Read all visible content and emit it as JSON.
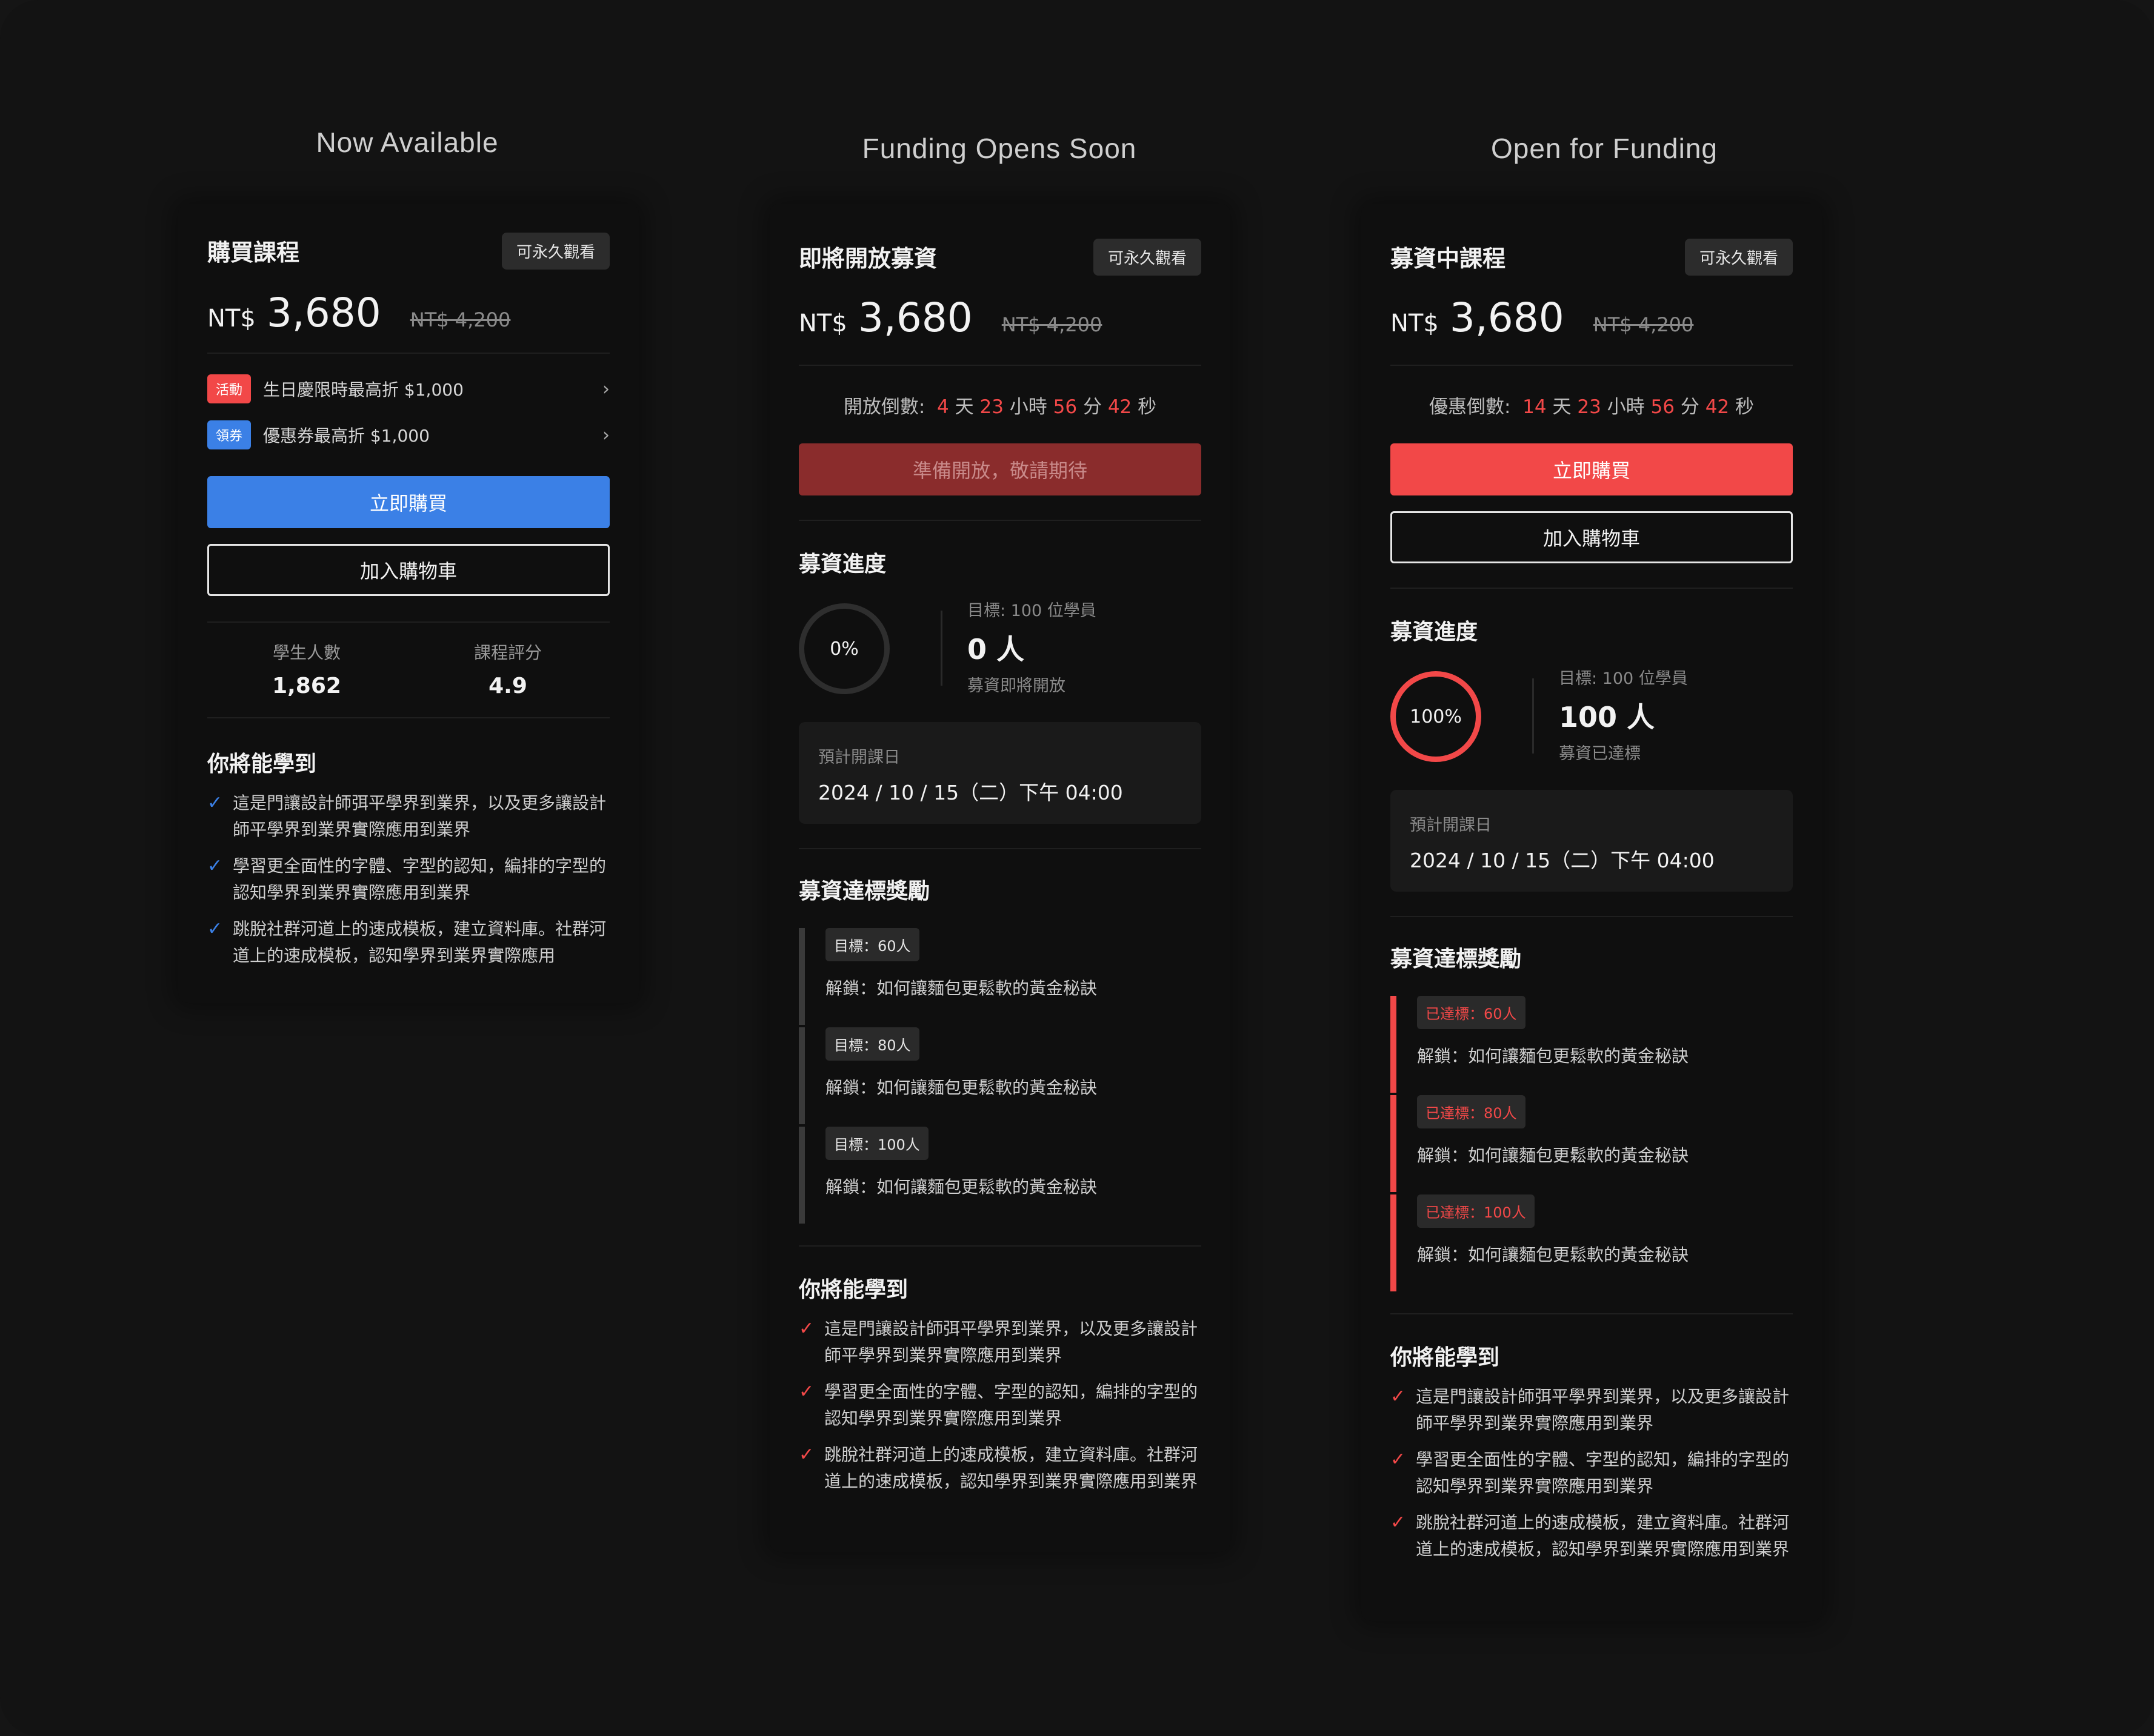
{
  "columns": [
    {
      "heading": "Now Available",
      "title": "購買課程",
      "badge": "可永久觀看",
      "currency": "NT$",
      "price": "3,680",
      "original_price": "NT$ 4,200",
      "promos": [
        {
          "tag": "活動",
          "tag_color": "#f24848",
          "text": "生日慶限時最高折 $1,000"
        },
        {
          "tag": "領券",
          "tag_color": "#3b80e6",
          "text": "優惠券最高折 $1,000"
        }
      ],
      "buy_label": "立即購買",
      "cart_label": "加入購物車",
      "stats": [
        {
          "label": "學生人數",
          "value": "1,862"
        },
        {
          "label": "課程評分",
          "value": "4.9"
        }
      ],
      "learn_title": "你將能學到",
      "learn_items": [
        "這是門讓設計師弭平學界到業界，以及更多讓設計師平學界到業界實際應用到業界",
        "學習更全面性的字體、字型的認知，編排的字型的認知學界到業界實際應用到業界",
        "跳脫社群河道上的速成模板，建立資料庫。社群河道上的速成模板，認知學界到業界實際應用"
      ]
    },
    {
      "heading": "Funding Opens Soon",
      "title": "即將開放募資",
      "badge": "可永久觀看",
      "currency": "NT$",
      "price": "3,680",
      "original_price": "NT$ 4,200",
      "countdown": {
        "label": "開放倒數:",
        "days": "4",
        "hours": "23",
        "mins": "56",
        "secs": "42",
        "u_day": "天",
        "u_hour": "小時",
        "u_min": "分",
        "u_sec": "秒"
      },
      "button_label": "準備開放，敬請期待",
      "progress_title": "募資進度",
      "progress_percent": "0%",
      "goal_label": "目標: 100 位學員",
      "goal_value": "0 人",
      "goal_status": "募資即將開放",
      "date_label": "預計開課日",
      "date_value": "2024 / 10 / 15（二）下午 04:00",
      "rewards_title": "募資達標獎勵",
      "milestones": [
        {
          "tag": "目標：60人",
          "text": "解鎖：如何讓麵包更鬆軟的黃金秘訣"
        },
        {
          "tag": "目標：80人",
          "text": "解鎖：如何讓麵包更鬆軟的黃金秘訣"
        },
        {
          "tag": "目標：100人",
          "text": "解鎖：如何讓麵包更鬆軟的黃金秘訣"
        }
      ],
      "learn_title": "你將能學到",
      "learn_items": [
        "這是門讓設計師弭平學界到業界，以及更多讓設計師平學界到業界實際應用到業界",
        "學習更全面性的字體、字型的認知，編排的字型的認知學界到業界實際應用到業界",
        "跳脫社群河道上的速成模板，建立資料庫。社群河道上的速成模板，認知學界到業界實際應用到業界"
      ]
    },
    {
      "heading": "Open for Funding",
      "title": "募資中課程",
      "badge": "可永久觀看",
      "currency": "NT$",
      "price": "3,680",
      "original_price": "NT$ 4,200",
      "countdown": {
        "label": "優惠倒數:",
        "days": "14",
        "hours": "23",
        "mins": "56",
        "secs": "42",
        "u_day": "天",
        "u_hour": "小時",
        "u_min": "分",
        "u_sec": "秒"
      },
      "buy_label": "立即購買",
      "cart_label": "加入購物車",
      "progress_title": "募資進度",
      "progress_percent": "100%",
      "goal_label": "目標: 100 位學員",
      "goal_value": "100 人",
      "goal_status": "募資已達標",
      "date_label": "預計開課日",
      "date_value": "2024 / 10 / 15（二）下午 04:00",
      "rewards_title": "募資達標獎勵",
      "milestones": [
        {
          "tag": "已達標：60人",
          "text": "解鎖：如何讓麵包更鬆軟的黃金秘訣"
        },
        {
          "tag": "已達標：80人",
          "text": "解鎖：如何讓麵包更鬆軟的黃金秘訣"
        },
        {
          "tag": "已達標：100人",
          "text": "解鎖：如何讓麵包更鬆軟的黃金秘訣"
        }
      ],
      "learn_title": "你將能學到",
      "learn_items": [
        "這是門讓設計師弭平學界到業界，以及更多讓設計師平學界到業界實際應用到業界",
        "學習更全面性的字體、字型的認知，編排的字型的認知學界到業界實際應用到業界",
        "跳脫社群河道上的速成模板，建立資料庫。社群河道上的速成模板，認知學界到業界實際應用到業界"
      ]
    }
  ],
  "colors": {
    "accent_red": "#f24848",
    "accent_blue": "#3b80e6",
    "disabled_red": "#8a2c2c"
  }
}
